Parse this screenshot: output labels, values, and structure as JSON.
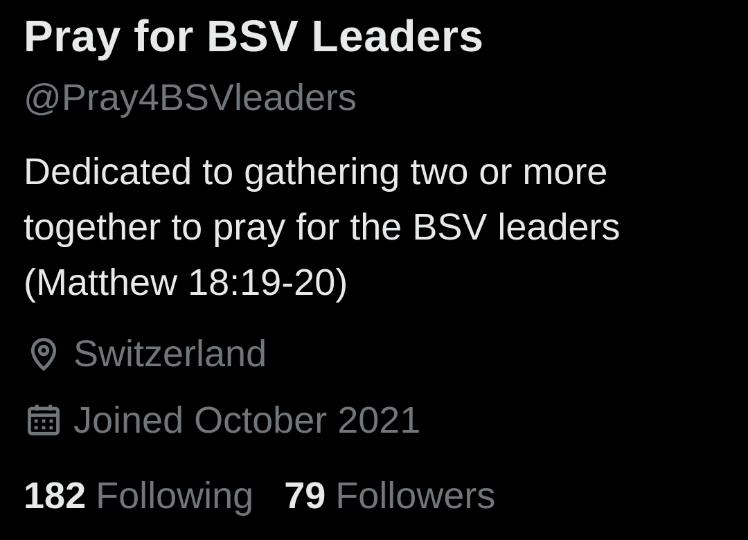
{
  "profile": {
    "display_name": "Pray for BSV Leaders",
    "handle": "@Pray4BSVleaders",
    "bio": "Dedicated to gathering two or more together to pray for the BSV leaders (Matthew 18:19-20)",
    "location": {
      "icon": "location-pin-icon",
      "text": "Switzerland"
    },
    "joined": {
      "icon": "calendar-icon",
      "text": "Joined October 2021"
    },
    "stats": {
      "following_count": "182",
      "following_label": "Following",
      "followers_count": "79",
      "followers_label": "Followers"
    }
  },
  "colors": {
    "background": "#000000",
    "primary_text": "#e7e9ea",
    "secondary_text": "#71767b"
  }
}
